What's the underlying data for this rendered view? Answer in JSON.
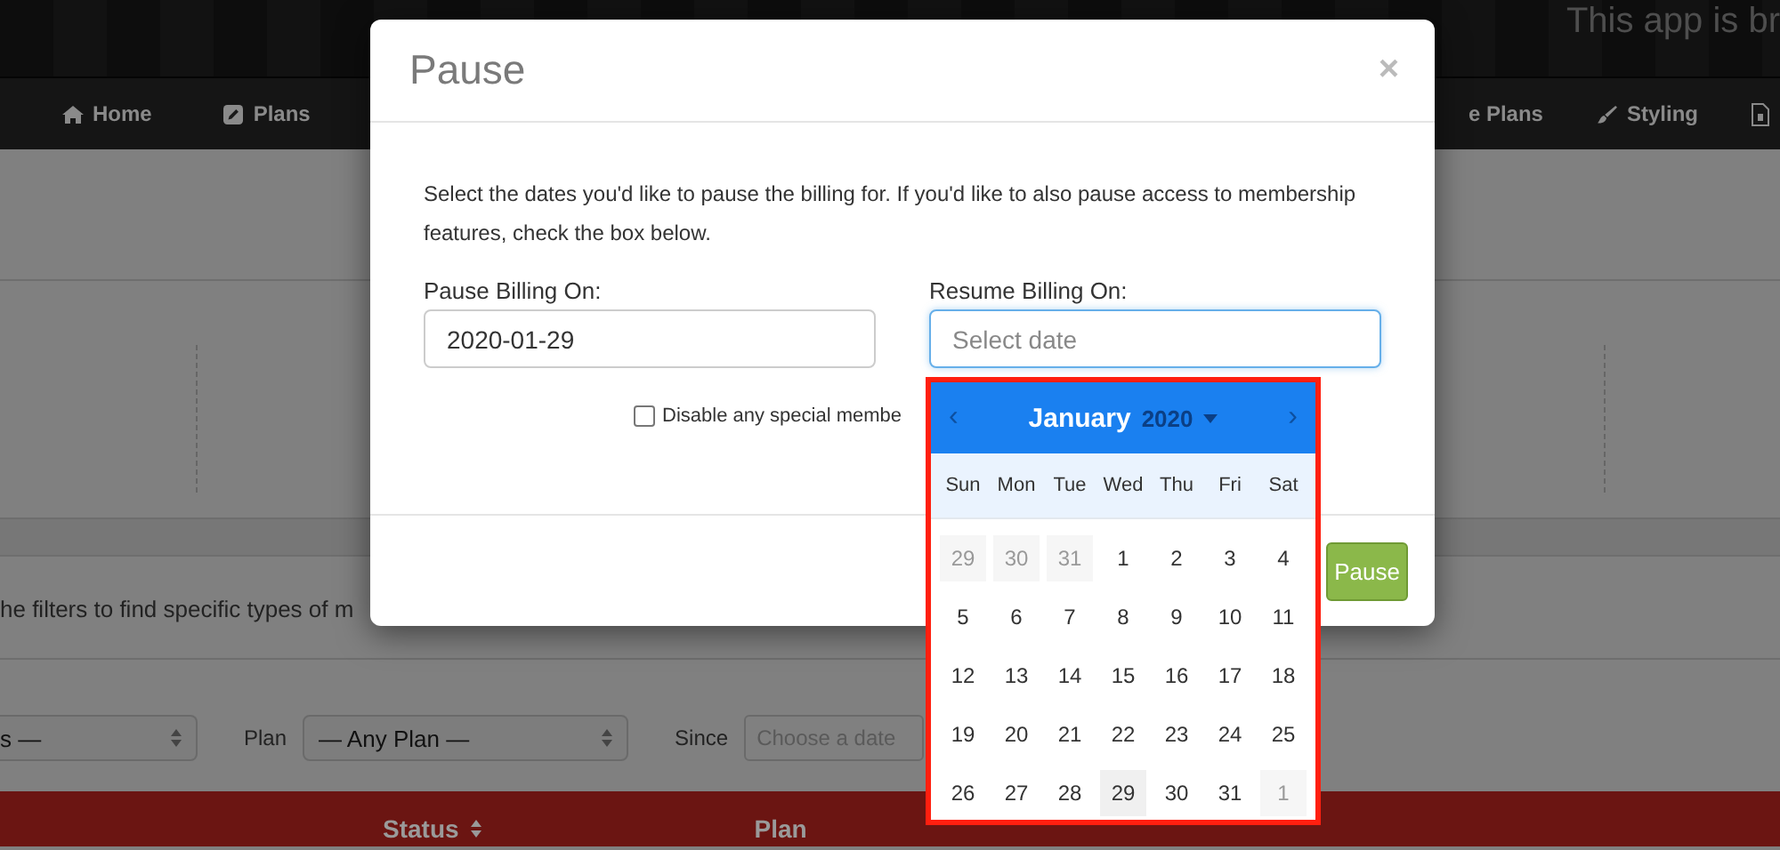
{
  "header": {
    "banner": "This app is br"
  },
  "nav": {
    "items": [
      {
        "label": "Home"
      },
      {
        "label": "Plans"
      },
      {
        "label": "e Plans"
      },
      {
        "label": "Styling"
      }
    ]
  },
  "page": {
    "intro": "he filters to find specific types of m",
    "filters": [
      {
        "kind": "select",
        "value": "s —"
      },
      {
        "kind": "label",
        "text": "Plan"
      },
      {
        "kind": "select",
        "value": "— Any Plan —"
      },
      {
        "kind": "label",
        "text": "Since"
      },
      {
        "kind": "date",
        "placeholder": "Choose a date"
      }
    ],
    "table": {
      "columns": [
        {
          "label": "Status",
          "sortable": true
        },
        {
          "label": "Plan",
          "sortable": false
        }
      ]
    }
  },
  "modal": {
    "title": "Pause",
    "close": "×",
    "description": "Select the dates you'd like to pause the billing for. If you'd like to also pause access to membership features, check the box below.",
    "fields": [
      {
        "label": "Pause Billing On:",
        "value": "2020-01-29",
        "focused": false
      },
      {
        "label": "Resume Billing On:",
        "placeholder": "Select date",
        "focused": true
      }
    ],
    "checkbox": {
      "label": "Disable any special membe",
      "checked": false
    },
    "buttons": [
      {
        "label": "Pause"
      }
    ]
  },
  "datepicker": {
    "prev": "‹",
    "month": "January",
    "year": "2020",
    "next": "›",
    "weekdays": [
      "Sun",
      "Mon",
      "Tue",
      "Wed",
      "Thu",
      "Fri",
      "Sat"
    ],
    "weeks": [
      [
        {
          "day": "29",
          "outside": true,
          "today": false
        },
        {
          "day": "30",
          "outside": true,
          "today": false
        },
        {
          "day": "31",
          "outside": true,
          "today": false
        },
        {
          "day": "1",
          "outside": false,
          "today": false
        },
        {
          "day": "2",
          "outside": false,
          "today": false
        },
        {
          "day": "3",
          "outside": false,
          "today": false
        },
        {
          "day": "4",
          "outside": false,
          "today": false
        }
      ],
      [
        {
          "day": "5",
          "outside": false,
          "today": false
        },
        {
          "day": "6",
          "outside": false,
          "today": false
        },
        {
          "day": "7",
          "outside": false,
          "today": false
        },
        {
          "day": "8",
          "outside": false,
          "today": false
        },
        {
          "day": "9",
          "outside": false,
          "today": false
        },
        {
          "day": "10",
          "outside": false,
          "today": false
        },
        {
          "day": "11",
          "outside": false,
          "today": false
        }
      ],
      [
        {
          "day": "12",
          "outside": false,
          "today": false
        },
        {
          "day": "13",
          "outside": false,
          "today": false
        },
        {
          "day": "14",
          "outside": false,
          "today": false
        },
        {
          "day": "15",
          "outside": false,
          "today": false
        },
        {
          "day": "16",
          "outside": false,
          "today": false
        },
        {
          "day": "17",
          "outside": false,
          "today": false
        },
        {
          "day": "18",
          "outside": false,
          "today": false
        }
      ],
      [
        {
          "day": "19",
          "outside": false,
          "today": false
        },
        {
          "day": "20",
          "outside": false,
          "today": false
        },
        {
          "day": "21",
          "outside": false,
          "today": false
        },
        {
          "day": "22",
          "outside": false,
          "today": false
        },
        {
          "day": "23",
          "outside": false,
          "today": false
        },
        {
          "day": "24",
          "outside": false,
          "today": false
        },
        {
          "day": "25",
          "outside": false,
          "today": false
        }
      ],
      [
        {
          "day": "26",
          "outside": false,
          "today": false
        },
        {
          "day": "27",
          "outside": false,
          "today": false
        },
        {
          "day": "28",
          "outside": false,
          "today": false
        },
        {
          "day": "29",
          "outside": false,
          "today": true
        },
        {
          "day": "30",
          "outside": false,
          "today": false
        },
        {
          "day": "31",
          "outside": false,
          "today": false
        },
        {
          "day": "1",
          "outside": true,
          "today": false
        }
      ]
    ]
  }
}
